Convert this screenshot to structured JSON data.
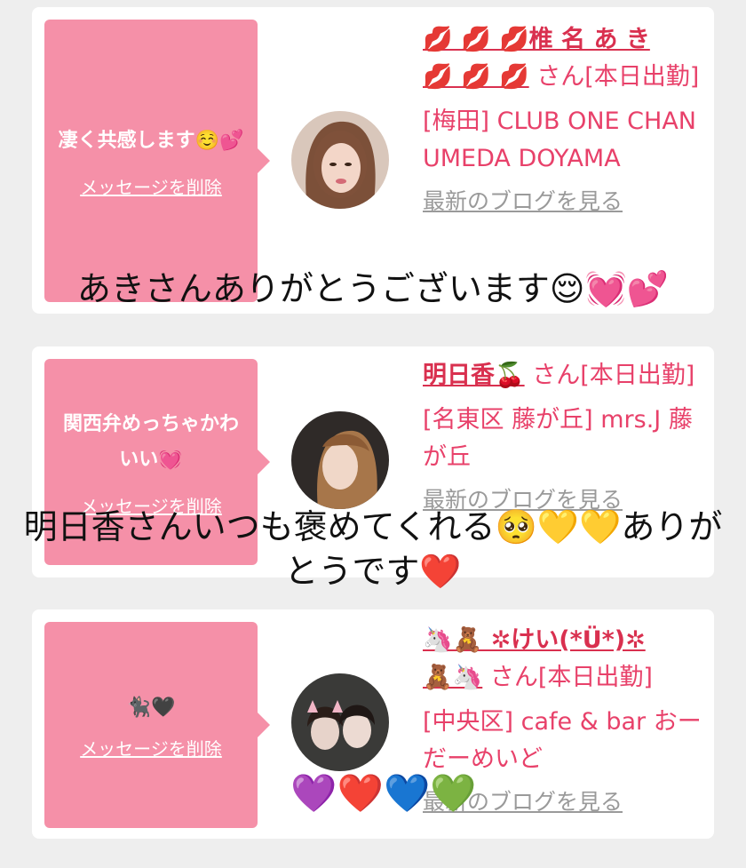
{
  "cards": [
    {
      "message": "凄く共感します☺️💕",
      "delete_label": "メッセージを削除",
      "name_line1": "💋 💋 💋椎 名 あ き",
      "name_line2": "💋 💋 💋",
      "san": "さん[本日出勤]",
      "shop": "[梅田] CLUB ONE CHAN UMEDA DOYAMA",
      "blog_label": "最新のブログを見る"
    },
    {
      "message": "関西弁めっちゃかわいい💓",
      "delete_label": "メッセージを削除",
      "name_line1": "明日香🍒",
      "san": "さん[本日出勤]",
      "shop": "[名東区 藤が丘] mrs.J 藤が丘",
      "blog_label": "最新のブログを見る"
    },
    {
      "message": "🐈‍⬛🖤",
      "delete_label": "メッセージを削除",
      "name_line1": "🦄🧸 ✲けい(*Ü*)✲",
      "name_line2": "🧸🦄",
      "san": "さん[本日出勤]",
      "shop": "[中央区] cafe & bar おーだーめいど",
      "blog_label": "最新のブログを見る"
    }
  ],
  "overlays": {
    "caption1": "あきさんありがとうございます😌💓💕",
    "caption2": "明日香さんいつも褒めてくれる🥺💛💛ありがとうです❤️",
    "caption3": "💜❤️💙💚"
  }
}
